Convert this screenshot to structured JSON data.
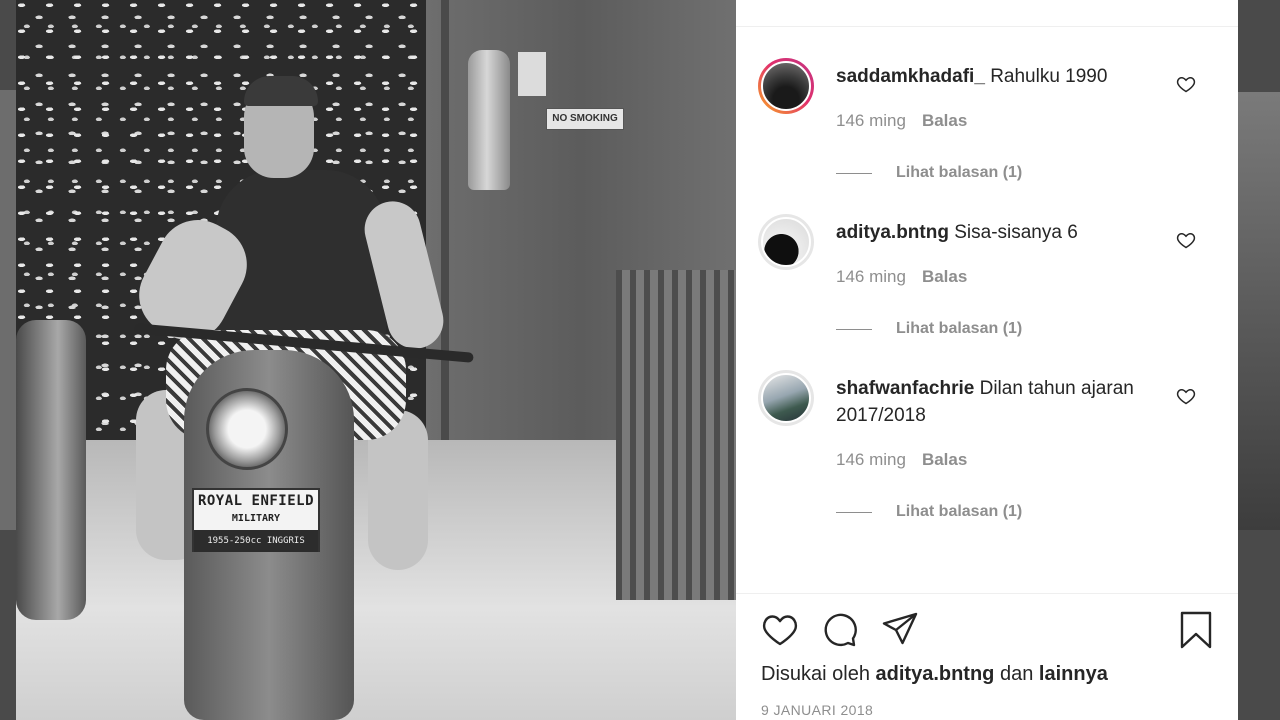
{
  "photo": {
    "sign_text": "NO SMOKING",
    "plate_line1": "ROYAL ENFIELD",
    "plate_line2": "MILITARY",
    "plate_line3": "1955-250cc INGGRIS"
  },
  "comments": [
    {
      "username": "saddamkhadafi_",
      "text": "Rahulku 1990",
      "time": "146 ming",
      "reply_label": "Balas",
      "view_replies": "Lihat balasan (1)",
      "avatar": "story-ring"
    },
    {
      "username": "aditya.bntng",
      "text": "Sisa-sisanya 6",
      "time": "146 ming",
      "reply_label": "Balas",
      "view_replies": "Lihat balasan (1)",
      "avatar": "plain"
    },
    {
      "username": "shafwanfachrie",
      "text": "Dilan tahun ajaran 2017/2018",
      "time": "146 ming",
      "reply_label": "Balas",
      "view_replies": "Lihat balasan (1)",
      "avatar": "plain"
    }
  ],
  "actions": {
    "icons": [
      "heart-icon",
      "comment-icon",
      "share-icon",
      "bookmark-icon"
    ]
  },
  "likes": {
    "prefix": "Disukai oleh",
    "user": "aditya.bntng",
    "middle": "dan",
    "others": "lainnya"
  },
  "date": "9 JANUARI 2018"
}
